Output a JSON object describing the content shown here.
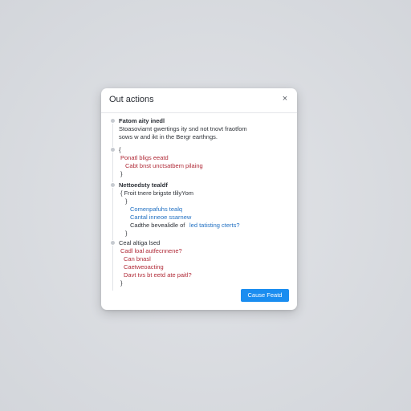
{
  "dialog": {
    "title": "Out actions",
    "close_label": "×",
    "primary_button": "Cause Featd"
  },
  "entries": [
    {
      "lines": [
        {
          "text": "Fatom aity inedl",
          "style": "bold"
        },
        {
          "text": "Stoasoviamt gwertings ity snd not tnovt fraotfom",
          "style": "dark"
        },
        {
          "text": "sows w and ikt in the Bergr earthngs.",
          "style": "dark"
        }
      ]
    },
    {
      "lines": [
        {
          "text": "{",
          "style": "dark"
        },
        {
          "text": "Ponatl bligs eeatd",
          "style": "red"
        },
        {
          "text": "Cabt  bnst unctsatbem pilaing",
          "style": "red"
        },
        {
          "text": "}",
          "style": "dark"
        }
      ]
    },
    {
      "lines": [
        {
          "text": "Nettoedsty tealdf",
          "style": "bold"
        },
        {
          "text": "{ Froit tnere brigste tlilyYom",
          "style": "dark"
        },
        {
          "text": "}",
          "style": "dark"
        },
        {
          "text": "Comenpafuhs tealq",
          "style": "blue"
        },
        {
          "text": "Cantal inneoe ssarnew",
          "style": "blue"
        },
        {
          "text": "Cadthe bevealidle of",
          "style": "dark"
        },
        {
          "text": "led tatisting cterts?",
          "style": "blue"
        },
        {
          "text": "}",
          "style": "dark"
        }
      ]
    },
    {
      "lines": [
        {
          "text": "Ceal altiga lsed",
          "style": "dark"
        },
        {
          "text": "Cadl  loal autfecnnene?",
          "style": "red"
        },
        {
          "text": "Can  bnasl",
          "style": "red"
        },
        {
          "text": "Caetweoacting",
          "style": "red"
        },
        {
          "text": "Davt  tvs bt eetd ate paitl?",
          "style": "red"
        },
        {
          "text": "}",
          "style": "dark"
        }
      ]
    }
  ]
}
